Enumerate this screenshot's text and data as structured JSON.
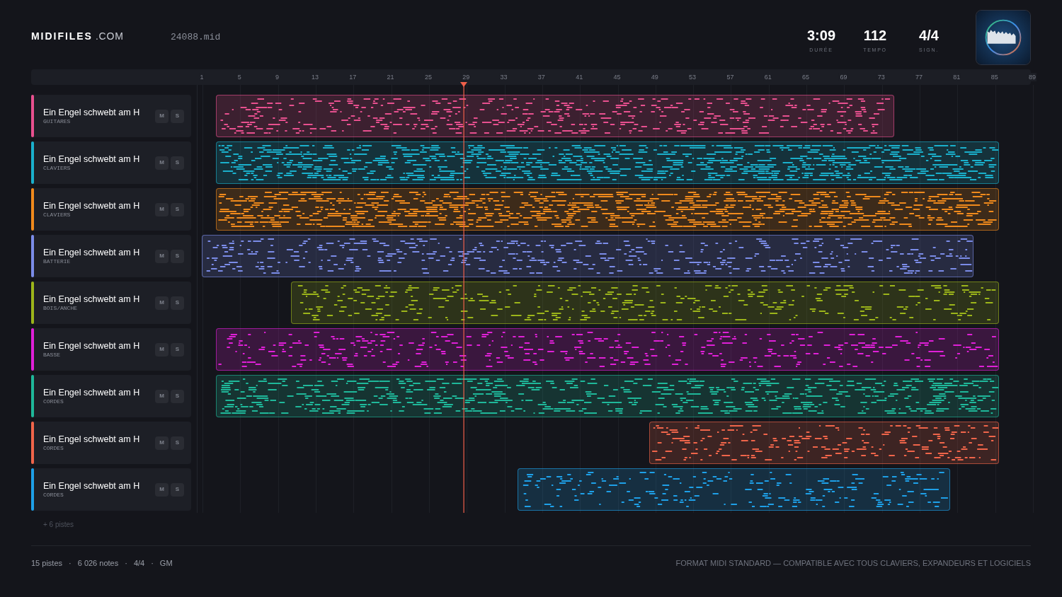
{
  "header": {
    "logo_bold": "MIDIFILES",
    "logo_suffix": ".COM",
    "filename": "24088.mid",
    "stats": [
      {
        "value": "3:09",
        "label": "DURÉE"
      },
      {
        "value": "112",
        "label": "TEMPO"
      },
      {
        "value": "4/4",
        "label": "SIGN."
      }
    ]
  },
  "ruler": {
    "labels": [
      "1",
      "5",
      "9",
      "13",
      "17",
      "21",
      "25",
      "29",
      "33",
      "37",
      "41",
      "45",
      "49",
      "53",
      "57",
      "61",
      "65",
      "69",
      "73",
      "77",
      "81",
      "85",
      "89"
    ]
  },
  "tracks": [
    {
      "name": "Ein Engel schwebt am H",
      "category": "GUITARES",
      "color": "#e8508f",
      "mute": "M",
      "solo": "S"
    },
    {
      "name": "Ein Engel schwebt am H",
      "category": "CLAVIERS",
      "color": "#1ab0cc",
      "mute": "M",
      "solo": "S"
    },
    {
      "name": "Ein Engel schwebt am H",
      "category": "CLAVIERS",
      "color": "#f08a1c",
      "mute": "M",
      "solo": "S"
    },
    {
      "name": "Ein Engel schwebt am H",
      "category": "BATTERIE",
      "color": "#7b8ce8",
      "mute": "M",
      "solo": "S"
    },
    {
      "name": "Ein Engel schwebt am H",
      "category": "BOIS/ANCHE",
      "color": "#9cb51a",
      "mute": "M",
      "solo": "S"
    },
    {
      "name": "Ein Engel schwebt am H",
      "category": "BASSE",
      "color": "#e020d8",
      "mute": "M",
      "solo": "S"
    },
    {
      "name": "Ein Engel schwebt am H",
      "category": "CORDES",
      "color": "#1fb89a",
      "mute": "M",
      "solo": "S"
    },
    {
      "name": "Ein Engel schwebt am H",
      "category": "CORDES",
      "color": "#f0654a",
      "mute": "M",
      "solo": "S"
    },
    {
      "name": "Ein Engel schwebt am H",
      "category": "CORDES",
      "color": "#1ea0e8",
      "mute": "M",
      "solo": "S"
    }
  ],
  "more_tracks": "+ 6 pistes",
  "footer": {
    "stats": [
      "15 pistes",
      "6 026 notes",
      "4/4",
      "GM"
    ],
    "separator": "·",
    "note": "FORMAT MIDI STANDARD — COMPATIBLE AVEC TOUS CLAVIERS, EXPANDEURS ET LOGICIELS"
  }
}
